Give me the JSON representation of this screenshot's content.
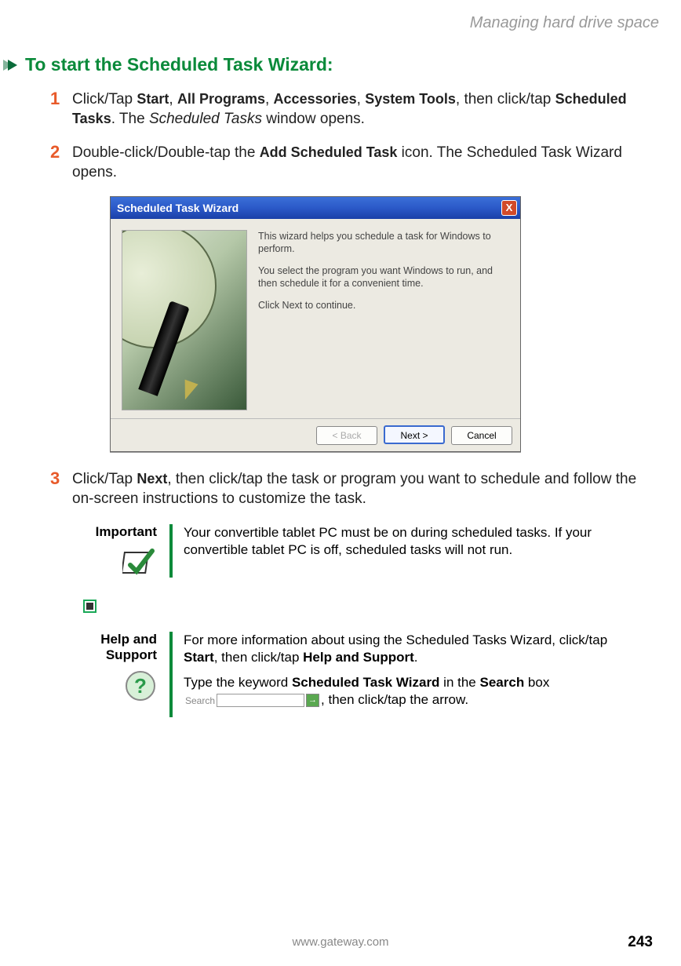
{
  "header": {
    "section": "Managing hard drive space"
  },
  "title": "To start the Scheduled Task Wizard:",
  "steps": [
    {
      "num": "1",
      "parts": {
        "p1": "Click/Tap ",
        "b1": "Start",
        "p2": ", ",
        "b2": "All Programs",
        "p3": ", ",
        "b3": "Accessories",
        "p4": ", ",
        "b4": "System Tools",
        "p5": ", then click/tap ",
        "b5": "Scheduled Tasks",
        "p6": ". The ",
        "i1": "Scheduled Tasks",
        "p7": " window opens."
      }
    },
    {
      "num": "2",
      "parts": {
        "p1": "Double-click/Double-tap the ",
        "b1": "Add Scheduled Task",
        "p2": " icon. The Scheduled Task Wizard opens."
      }
    },
    {
      "num": "3",
      "parts": {
        "p1": "Click/Tap ",
        "b1": "Next",
        "p2": ", then click/tap the task or program you want to schedule and follow the on-screen instructions to customize the task."
      }
    }
  ],
  "wizard": {
    "title": "Scheduled Task Wizard",
    "close": "X",
    "body": {
      "line1": "This wizard helps you schedule a task for Windows to perform.",
      "line2": "You select the program you want Windows to run, and then schedule it for a convenient time.",
      "line3": "Click Next to continue."
    },
    "buttons": {
      "back": "< Back",
      "next": "Next >",
      "cancel": "Cancel"
    }
  },
  "callouts": {
    "important": {
      "label": "Important",
      "text": "Your convertible tablet PC must be on during scheduled tasks. If your convertible tablet PC is off, scheduled tasks will not run."
    },
    "help": {
      "label": "Help and Support",
      "p1a": "For more information about using the Scheduled Tasks Wizard, click/tap ",
      "p1b": "Start",
      "p1c": ", then click/tap ",
      "p1d": "Help and Support",
      "p1e": ".",
      "p2a": "Type the keyword ",
      "p2b": "Scheduled Task Wizard",
      "p2c": " in the ",
      "p2d": "Search",
      "p2e": " box ",
      "search_label": "Search",
      "arrow": "→",
      "p2f": ", then click/tap the arrow."
    }
  },
  "footer": {
    "url": "www.gateway.com",
    "page": "243"
  }
}
